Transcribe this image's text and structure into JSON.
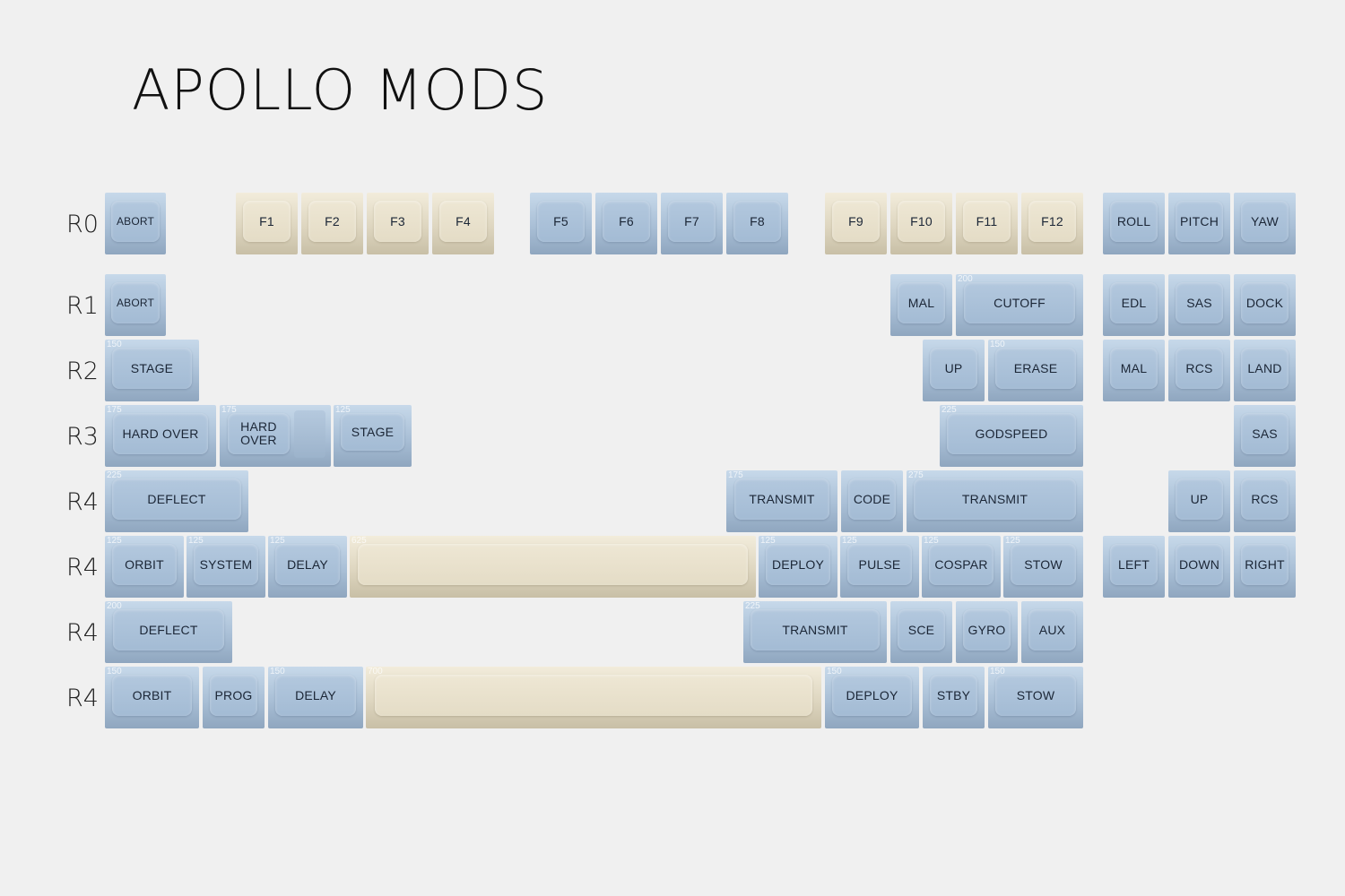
{
  "title": "APOLLO MODS",
  "colors": {
    "background": "#f0f0f0",
    "blue_keycap": "#a9bfd6",
    "cream_keycap": "#e4dcc6",
    "legend": "#1b2636"
  },
  "row_labels": [
    "R0",
    "R1",
    "R2",
    "R3",
    "R4",
    "R4",
    "R4",
    "R4"
  ],
  "keys": {
    "r0_abort": "ABORT",
    "f1": "F1",
    "f2": "F2",
    "f3": "F3",
    "f4": "F4",
    "f5": "F5",
    "f6": "F6",
    "f7": "F7",
    "f8": "F8",
    "f9": "F9",
    "f10": "F10",
    "f11": "F11",
    "f12": "F12",
    "roll": "ROLL",
    "pitch": "PITCH",
    "yaw": "YAW",
    "r1_abort": "ABORT",
    "r1_mal": "MAL",
    "cutoff": "CUTOFF",
    "cutoff_size": "200",
    "edl": "EDL",
    "r1_sas": "SAS",
    "dock": "DOCK",
    "r2_stage": "STAGE",
    "r2_stage_size": "150",
    "r2_up": "UP",
    "erase": "ERASE",
    "erase_size": "150",
    "r2_mal": "MAL",
    "r2_rcs": "RCS",
    "land": "LAND",
    "hard_over_1": "HARD OVER",
    "hard_over_1_size": "175",
    "hard_over_2": "HARD\nOVER",
    "hard_over_2_size": "175",
    "r3_stage": "STAGE",
    "r3_stage_size": "125",
    "godspeed": "GODSPEED",
    "godspeed_size": "225",
    "r3_sas": "SAS",
    "r4a_deflect": "DEFLECT",
    "r4a_deflect_size": "225",
    "r4a_transmit_1": "TRANSMIT",
    "r4a_transmit_1_size": "175",
    "code": "CODE",
    "r4a_transmit_2": "TRANSMIT",
    "r4a_transmit_2_size": "275",
    "r4a_up": "UP",
    "r4a_rcs": "RCS",
    "r4b_orbit": "ORBIT",
    "r4b_orbit_size": "125",
    "system": "SYSTEM",
    "system_size": "125",
    "r4b_delay": "DELAY",
    "r4b_delay_size": "125",
    "r4b_space_size": "625",
    "r4b_deploy": "DEPLOY",
    "r4b_deploy_size": "125",
    "pulse": "PULSE",
    "pulse_size": "125",
    "cospar": "COSPAR",
    "cospar_size": "125",
    "r4b_stow": "STOW",
    "r4b_stow_size": "125",
    "left": "LEFT",
    "down": "DOWN",
    "right": "RIGHT",
    "r4c_deflect": "DEFLECT",
    "r4c_deflect_size": "200",
    "r4c_transmit": "TRANSMIT",
    "r4c_transmit_size": "225",
    "sce": "SCE",
    "gyro": "GYRO",
    "aux": "AUX",
    "r4d_orbit": "ORBIT",
    "r4d_orbit_size": "150",
    "prog": "PROG",
    "r4d_delay": "DELAY",
    "r4d_delay_size": "150",
    "r4d_space_size": "700",
    "r4d_deploy": "DEPLOY",
    "r4d_deploy_size": "150",
    "stby": "STBY",
    "r4d_stow": "STOW",
    "r4d_stow_size": "150"
  }
}
